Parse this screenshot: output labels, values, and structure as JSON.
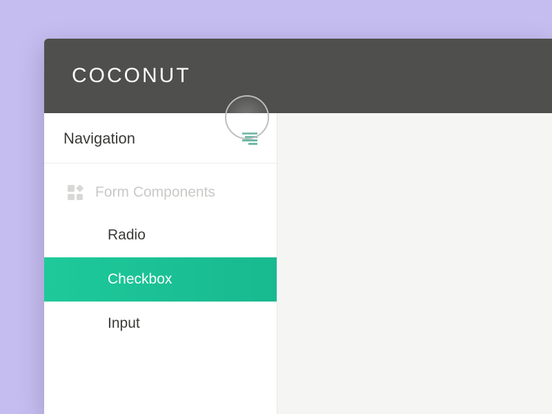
{
  "header": {
    "title": "COCONUT"
  },
  "sidebar": {
    "title": "Navigation",
    "section": {
      "label": "Form Components",
      "items": [
        {
          "label": "Radio",
          "active": false
        },
        {
          "label": "Checkbox",
          "active": true
        },
        {
          "label": "Input",
          "active": false
        }
      ]
    }
  }
}
